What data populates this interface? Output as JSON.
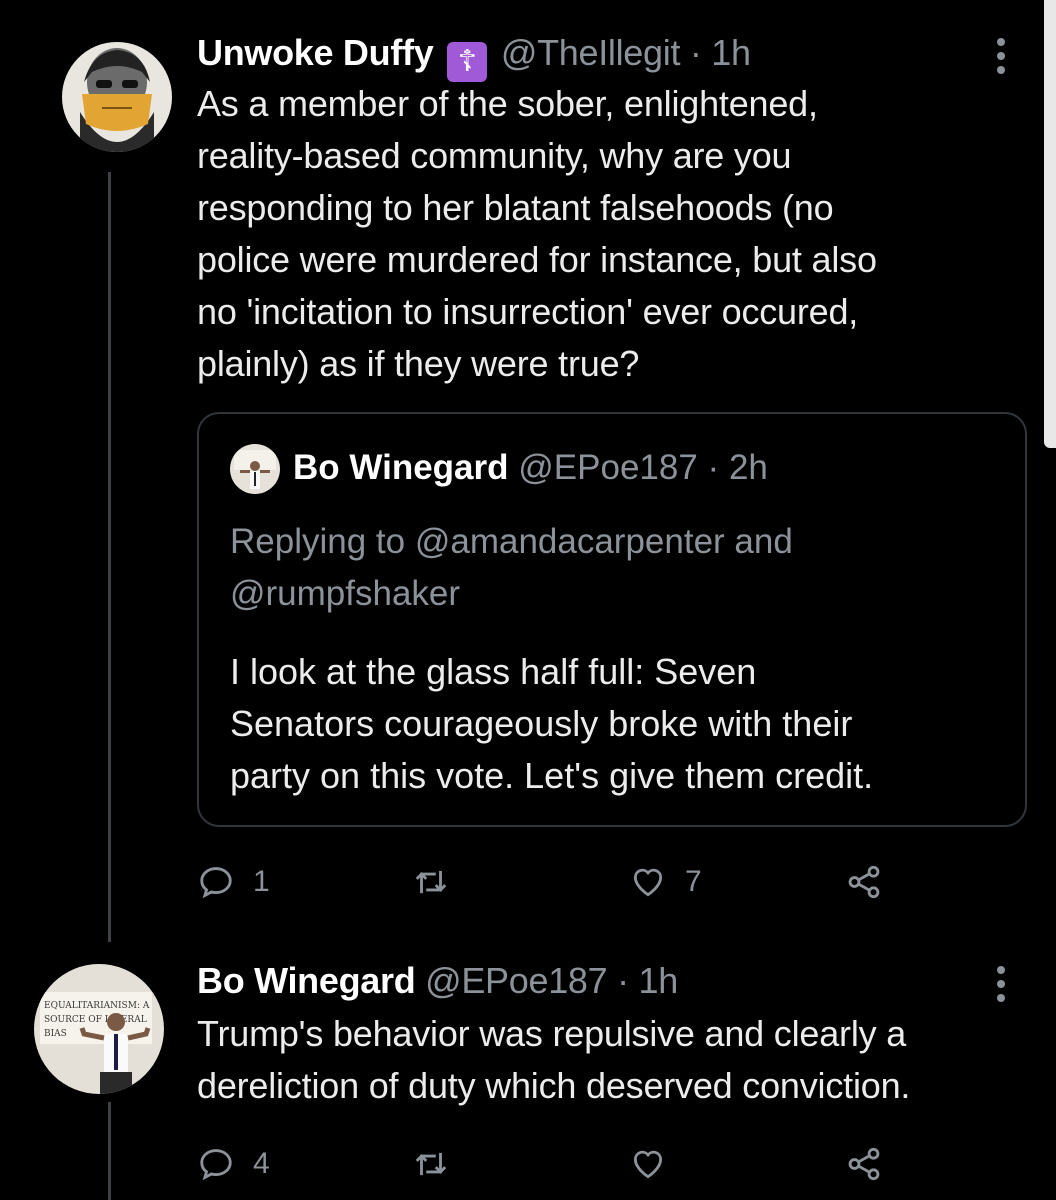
{
  "tweets": [
    {
      "name": "Unwoke Duffy",
      "badge": "☦",
      "handle": "@TheIllegit",
      "time": "1h",
      "text_lines": [
        "As a member of the sober, enlightened,",
        "reality-based community, why are you",
        "responding to her blatant falsehoods (no",
        "police were murdered for instance, but also",
        "no 'incitation to insurrection' ever occured,",
        "plainly) as if they were true?"
      ],
      "quoted": {
        "name": "Bo Winegard",
        "handle": "@EPoe187",
        "time": "2h",
        "reply_lines": [
          "Replying to @amandacarpenter and",
          "@rumpfshaker"
        ],
        "text_lines": [
          "I look at the glass half full: Seven",
          "Senators courageously broke with their",
          "party on this vote. Let's give them credit."
        ]
      },
      "actions": {
        "replies": "1",
        "retweets": "",
        "likes": "7"
      }
    },
    {
      "name": "Bo Winegard",
      "handle": "@EPoe187",
      "time": "1h",
      "text_lines": [
        "Trump's behavior was repulsive and clearly a",
        "dereliction of duty which deserved conviction."
      ],
      "avatar_sign": [
        "EQUALITARIANISM: A",
        "SOURCE OF LIBERAL",
        "BIAS"
      ],
      "actions": {
        "replies": "4",
        "retweets": "",
        "likes": ""
      }
    }
  ],
  "separator": "·",
  "colors": {
    "background": "#000000",
    "secondary_text": "#8b9299",
    "badge": "#a05ad8"
  }
}
